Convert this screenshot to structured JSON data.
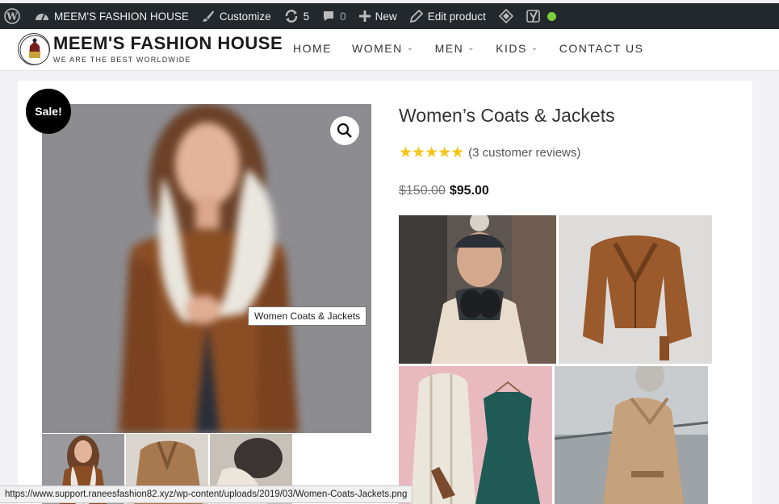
{
  "adminbar": {
    "site_name": "MEEM'S FASHION HOUSE",
    "customize": "Customize",
    "updates_count": "5",
    "comments_count": "0",
    "new": "New",
    "edit_product": "Edit product"
  },
  "header": {
    "title": "MEEM'S FASHION HOUSE",
    "tagline": "WE ARE THE BEST WORLDWIDE",
    "nav": [
      "HOME",
      "WOMEN",
      "MEN",
      "KIDS",
      "CONTACT US"
    ]
  },
  "product": {
    "sale_badge": "Sale!",
    "title": "Women’s Coats & Jackets",
    "stars": "★★★★★",
    "rating": 5,
    "reviews": "(3 customer reviews)",
    "old_price": "$150.00",
    "new_price": "$95.00",
    "image_tooltip": "Women Coats & Jackets"
  },
  "status_url": "https://www.support.raneesfashion82.xyz/wp-content/uploads/2019/03/Women-Coats-Jackets.png",
  "colors": {
    "adminbar_bg": "#23282d",
    "star": "#f5c518",
    "sale_bg": "#000000",
    "status_dot": "#7ad03a"
  }
}
